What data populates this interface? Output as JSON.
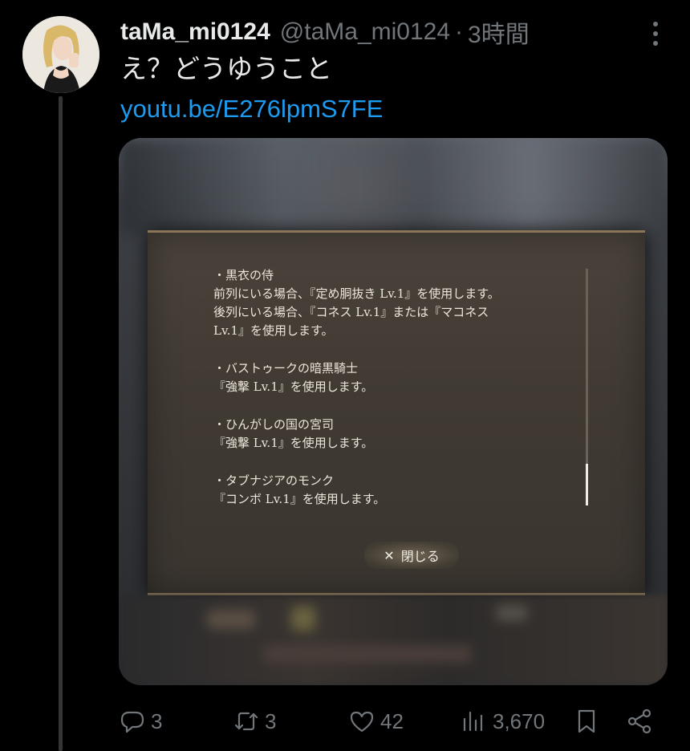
{
  "tweet": {
    "display_name": "taMa_mi0124",
    "handle": "@taMa_mi0124",
    "separator": "·",
    "timestamp": "3時間",
    "text": "え？どうゆうこと",
    "link": "youtu.be/E276lpmS7FE"
  },
  "media": {
    "dialog_entries": [
      {
        "lines": [
          "・黒衣の侍",
          "前列にいる場合、『定め胴抜き Lv.1』を使用します。",
          "後列にいる場合、『コネス Lv.1』または『マコネス",
          "Lv.1』を使用します。"
        ]
      },
      {
        "lines": [
          "・バストゥークの暗黒騎士",
          "『強撃 Lv.1』を使用します。"
        ]
      },
      {
        "lines": [
          "・ひんがしの国の宮司",
          "『強撃 Lv.1』を使用します。"
        ]
      },
      {
        "lines": [
          "・タブナジアのモンク",
          "『コンボ Lv.1』を使用します。"
        ]
      }
    ],
    "close_label": "閉じる",
    "close_icon": "✕"
  },
  "actions": {
    "replies": "3",
    "reposts": "3",
    "likes": "42",
    "views": "3,670"
  },
  "icons": {
    "reply": "reply-icon",
    "repost": "repost-icon",
    "like": "heart-icon",
    "views": "views-icon",
    "bookmark": "bookmark-icon",
    "share": "share-icon",
    "more": "more-options-icon"
  },
  "colors": {
    "background": "#000000",
    "text": "#e7e9ea",
    "muted": "#71767b",
    "link": "#1d9bf0"
  }
}
